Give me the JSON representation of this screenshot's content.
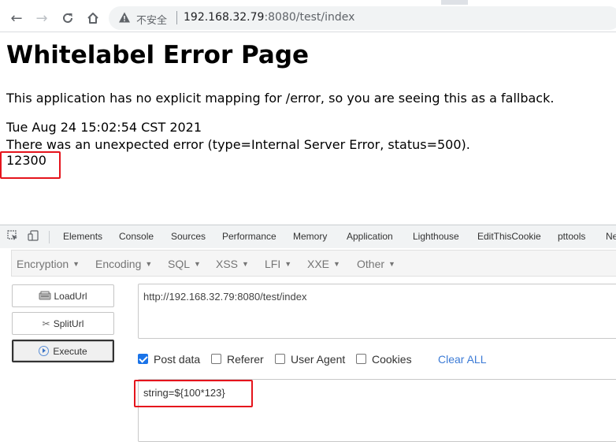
{
  "browser": {
    "insecure_label": "不安全",
    "url_host": "192.168.32.79",
    "url_rest": ":8080/test/index",
    "icons": [
      "back-icon",
      "forward-icon",
      "reload-icon",
      "home-icon",
      "warning-icon"
    ]
  },
  "page": {
    "title": "Whitelabel Error Page",
    "description": "This application has no explicit mapping for /error, so you are seeing this as a fallback.",
    "timestamp": "Tue Aug 24 15:02:54 CST 2021",
    "error_line": "There was an unexpected error (type=Internal Server Error, status=500).",
    "result": "12300",
    "highlight_color": "#e5141c"
  },
  "devtools": {
    "tabs": [
      "Elements",
      "Console",
      "Sources",
      "Performance",
      "Memory",
      "Application",
      "Lighthouse",
      "EditThisCookie",
      "pttools",
      "Ne"
    ]
  },
  "hackbar": {
    "menu": [
      "Encryption",
      "Encoding",
      "SQL",
      "XSS",
      "LFI",
      "XXE",
      "Other"
    ],
    "load_url_label": "LoadUrl",
    "split_url_label": "SplitUrl",
    "execute_label": "Execute",
    "url_value": "http://192.168.32.79:8080/test/index",
    "options": {
      "post_data": "Post data",
      "referer": "Referer",
      "user_agent": "User Agent",
      "cookies": "Cookies",
      "post_data_checked": true,
      "referer_checked": false,
      "user_agent_checked": false,
      "cookies_checked": false
    },
    "clear_all_label": "Clear ALL",
    "post_value": "string=${100*123}"
  }
}
